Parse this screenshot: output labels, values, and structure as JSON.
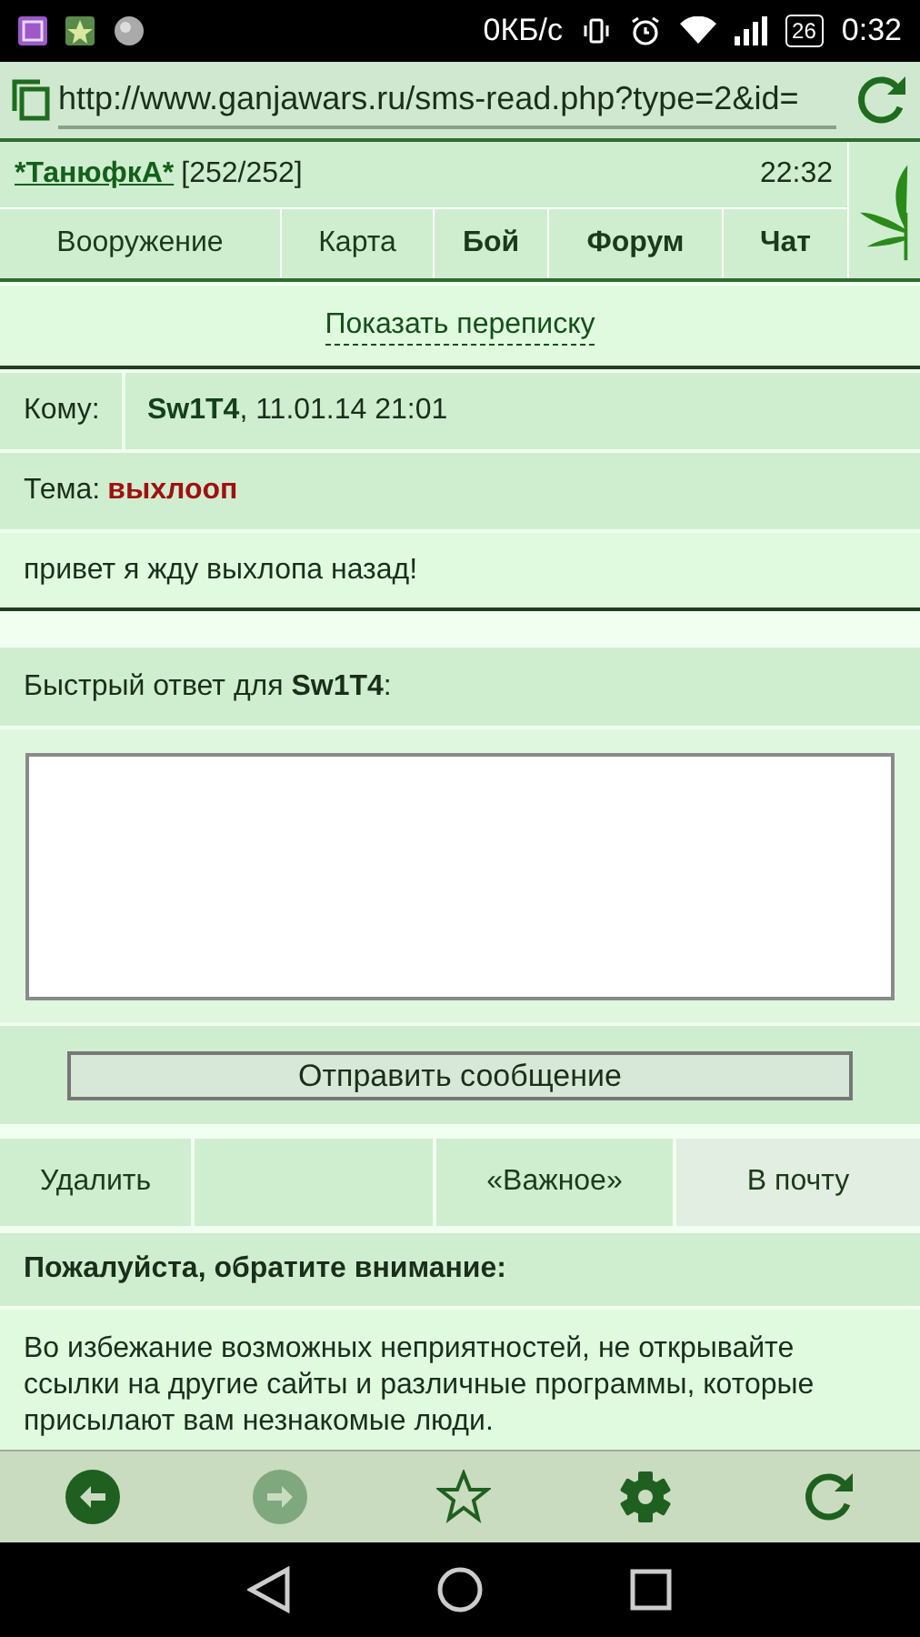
{
  "status_bar": {
    "speed": "0КБ/с",
    "battery": "26",
    "time": "0:32"
  },
  "address_bar": {
    "url": "http://www.ganjawars.ru/sms-read.php?type=2&id="
  },
  "header": {
    "user": "*ТанюфкА*",
    "hp": "[252/252]",
    "time": "22:32"
  },
  "nav": [
    {
      "label": "Вооружение",
      "bold": false
    },
    {
      "label": "Карта",
      "bold": false
    },
    {
      "label": "Бой",
      "bold": true
    },
    {
      "label": "Форум",
      "bold": true
    },
    {
      "label": "Чат",
      "bold": true
    }
  ],
  "show_thread": "Показать переписку",
  "message": {
    "to_label": "Кому:",
    "to_name": "Sw1T4",
    "to_date": ", 11.01.14 21:01",
    "subject_label": "Тема:",
    "subject": "выхлооп",
    "body": "привет я жду выхлопа назад!"
  },
  "quick_reply": {
    "label": "Быстрый ответ для **Sw1T4**:",
    "button": "Отправить сообщение"
  },
  "actions": [
    {
      "label": "Удалить",
      "highlighted": false
    },
    {
      "highlighted": false
    },
    {
      "label": "«Важное»",
      "highlighted": false
    },
    {
      "label": "В почту",
      "highlighted": true
    }
  ],
  "notice": {
    "title": "Пожалуйста, обратите внимание:",
    "text": "Во избежание возможных неприятностей, не открывайте ссылки на другие сайты и различные программы, которые присылают вам незнакомые люди."
  },
  "toolbar": [
    {
      "kind": "back",
      "disabled": false
    },
    {
      "kind": "forward",
      "disabled": true
    },
    {
      "kind": "star",
      "disabled": false
    },
    {
      "kind": "settings",
      "disabled": false
    },
    {
      "kind": "reload",
      "disabled": false
    }
  ]
}
